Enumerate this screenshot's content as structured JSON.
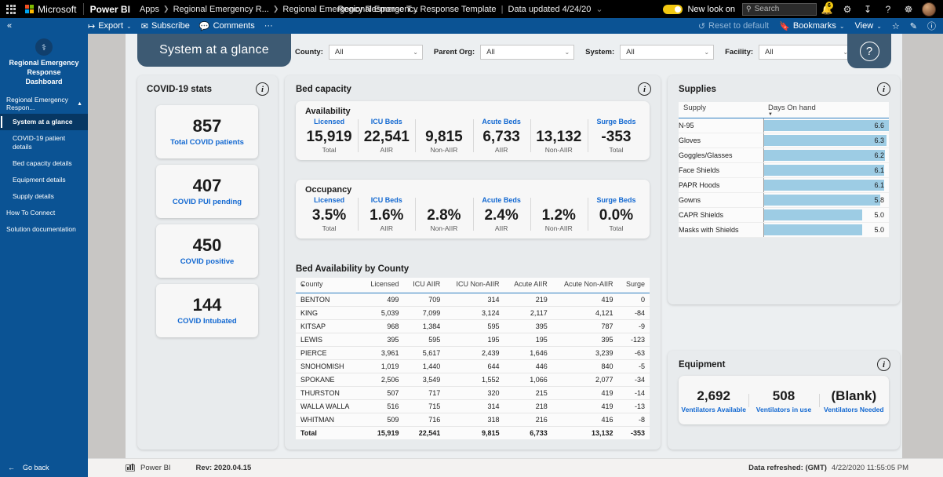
{
  "topbar": {
    "waffle_icon": "waffle-grid-icon",
    "microsoft_label": "Microsoft",
    "product_label": "Power BI",
    "breadcrumbs": [
      "Apps",
      "Regional Emergency R...",
      "Regional Emergency Response T..."
    ],
    "center_title": "Regional Emergency Response Template",
    "center_updated": "Data updated 4/24/20",
    "new_look_label": "New look on",
    "search_placeholder": "Search",
    "notification_count": "6",
    "icons": [
      "bell-icon",
      "gear-icon",
      "download-icon",
      "help-icon",
      "globe-icon",
      "avatar"
    ]
  },
  "ribbon": {
    "collapse_icon": "double-chevron-left-icon",
    "export_label": "Export",
    "subscribe_label": "Subscribe",
    "comments_label": "Comments",
    "more_label": "···",
    "reset_label": "Reset to default",
    "bookmarks_label": "Bookmarks",
    "view_label": "View",
    "favorite_icon": "star-icon",
    "edit_icon": "pencil-icon",
    "info_icon": "info-circle-icon"
  },
  "sidebar": {
    "logo_icon": "caduceus-icon",
    "title": "Regional Emergency Response Dashboard",
    "group_label": "Regional Emergency Respon...",
    "group_chevron": "chevron-up-icon",
    "items": [
      {
        "label": "System at a glance",
        "active": true,
        "indent": true
      },
      {
        "label": "COVID-19 patient details",
        "active": false,
        "indent": true
      },
      {
        "label": "Bed capacity details",
        "active": false,
        "indent": true
      },
      {
        "label": "Equipment details",
        "active": false,
        "indent": true
      },
      {
        "label": "Supply details",
        "active": false,
        "indent": true
      },
      {
        "label": "How To Connect",
        "active": false,
        "indent": false
      },
      {
        "label": "Solution documentation",
        "active": false,
        "indent": false
      }
    ],
    "go_back_label": "Go back",
    "go_back_icon": "arrow-left-icon"
  },
  "report": {
    "page_tab_label": "System at a glance",
    "slicers": [
      {
        "label": "County:",
        "value": "All"
      },
      {
        "label": "Parent Org:",
        "value": "All"
      },
      {
        "label": "System:",
        "value": "All"
      },
      {
        "label": "Facility:",
        "value": "All"
      }
    ],
    "help_icon": "question-mark-icon"
  },
  "covid_stats": {
    "title": "COVID-19 stats",
    "info_icon": "info-icon",
    "tiles": [
      {
        "value": "857",
        "label": "Total COVID patients"
      },
      {
        "value": "407",
        "label": "COVID PUI pending"
      },
      {
        "value": "450",
        "label": "COVID positive"
      },
      {
        "value": "144",
        "label": "COVID Intubated"
      }
    ]
  },
  "bed_capacity": {
    "title": "Bed capacity",
    "info_icon": "info-icon",
    "availability": {
      "title": "Availability",
      "metrics": [
        {
          "head": "Licensed",
          "value": "15,919",
          "sub": "Total"
        },
        {
          "head": "ICU Beds",
          "value": "22,541",
          "sub": "AIIR"
        },
        {
          "head": "",
          "value": "9,815",
          "sub": "Non-AIIR"
        },
        {
          "head": "Acute Beds",
          "value": "6,733",
          "sub": "AIIR"
        },
        {
          "head": "",
          "value": "13,132",
          "sub": "Non-AIIR"
        },
        {
          "head": "Surge Beds",
          "value": "-353",
          "sub": "Total"
        }
      ]
    },
    "occupancy": {
      "title": "Occupancy",
      "metrics": [
        {
          "head": "Licensed",
          "value": "3.5%",
          "sub": "Total"
        },
        {
          "head": "ICU Beds",
          "value": "1.6%",
          "sub": "AIIR"
        },
        {
          "head": "",
          "value": "2.8%",
          "sub": "Non-AIIR"
        },
        {
          "head": "Acute Beds",
          "value": "2.4%",
          "sub": "AIIR"
        },
        {
          "head": "",
          "value": "1.2%",
          "sub": "Non-AIIR"
        },
        {
          "head": "Surge Beds",
          "value": "0.0%",
          "sub": "Total"
        }
      ]
    }
  },
  "county_table": {
    "title": "Bed Availability by County",
    "columns": [
      "County",
      "Licensed",
      "ICU AIIR",
      "ICU Non-AIIR",
      "Acute AIIR",
      "Acute Non-AIIR",
      "Surge"
    ],
    "sort_column": "County",
    "sort_direction": "asc",
    "rows": [
      [
        "BENTON",
        "499",
        "709",
        "314",
        "219",
        "419",
        "0"
      ],
      [
        "KING",
        "5,039",
        "7,099",
        "3,124",
        "2,117",
        "4,121",
        "-84"
      ],
      [
        "KITSAP",
        "968",
        "1,384",
        "595",
        "395",
        "787",
        "-9"
      ],
      [
        "LEWIS",
        "395",
        "595",
        "195",
        "195",
        "395",
        "-123"
      ],
      [
        "PIERCE",
        "3,961",
        "5,617",
        "2,439",
        "1,646",
        "3,239",
        "-63"
      ],
      [
        "SNOHOMISH",
        "1,019",
        "1,440",
        "644",
        "446",
        "840",
        "-5"
      ],
      [
        "SPOKANE",
        "2,506",
        "3,549",
        "1,552",
        "1,066",
        "2,077",
        "-34"
      ],
      [
        "THURSTON",
        "507",
        "717",
        "320",
        "215",
        "419",
        "-14"
      ],
      [
        "WALLA WALLA",
        "516",
        "715",
        "314",
        "218",
        "419",
        "-13"
      ],
      [
        "WHITMAN",
        "509",
        "716",
        "318",
        "216",
        "416",
        "-8"
      ]
    ],
    "total_row": [
      "Total",
      "15,919",
      "22,541",
      "9,815",
      "6,733",
      "13,132",
      "-353"
    ]
  },
  "supplies": {
    "title": "Supplies",
    "info_icon": "info-icon",
    "columns": [
      "Supply",
      "Days On hand"
    ],
    "sort_column": "Days On hand",
    "sort_direction": "desc",
    "max_value": 6.6,
    "rows": [
      {
        "name": "N-95",
        "value": "6.6",
        "pct": 100
      },
      {
        "name": "Gloves",
        "value": "6.3",
        "pct": 98
      },
      {
        "name": "Goggles/Glasses",
        "value": "6.2",
        "pct": 97
      },
      {
        "name": "Face Shields",
        "value": "6.1",
        "pct": 96
      },
      {
        "name": "PAPR Hoods",
        "value": "6.1",
        "pct": 96
      },
      {
        "name": "Gowns",
        "value": "5.8",
        "pct": 93
      },
      {
        "name": "CAPR Shields",
        "value": "5.0",
        "pct": 79
      },
      {
        "name": "Masks with Shields",
        "value": "5.0",
        "pct": 79
      }
    ]
  },
  "equipment": {
    "title": "Equipment",
    "info_icon": "info-icon",
    "metrics": [
      {
        "value": "2,692",
        "label": "Ventilators Available"
      },
      {
        "value": "508",
        "label": "Ventilators in use"
      },
      {
        "value": "(Blank)",
        "label": "Ventilators Needed"
      }
    ]
  },
  "statusbar": {
    "brand": "Power BI",
    "rev": "Rev: 2020.04.15",
    "refreshed_label": "Data refreshed: (GMT)",
    "refreshed_value": "4/22/2020 11:55:05 PM"
  },
  "chart_data": {
    "type": "bar",
    "title": "Supplies — Days On hand",
    "categories": [
      "N-95",
      "Gloves",
      "Goggles/Glasses",
      "Face Shields",
      "PAPR Hoods",
      "Gowns",
      "CAPR Shields",
      "Masks with Shields"
    ],
    "values": [
      6.6,
      6.3,
      6.2,
      6.1,
      6.1,
      5.8,
      5.0,
      5.0
    ],
    "xlabel": "Days On hand",
    "ylabel": "Supply",
    "xlim": [
      0,
      6.6
    ],
    "grid": false,
    "legend": false,
    "bar_color": "#9dcce4",
    "orientation": "horizontal"
  }
}
